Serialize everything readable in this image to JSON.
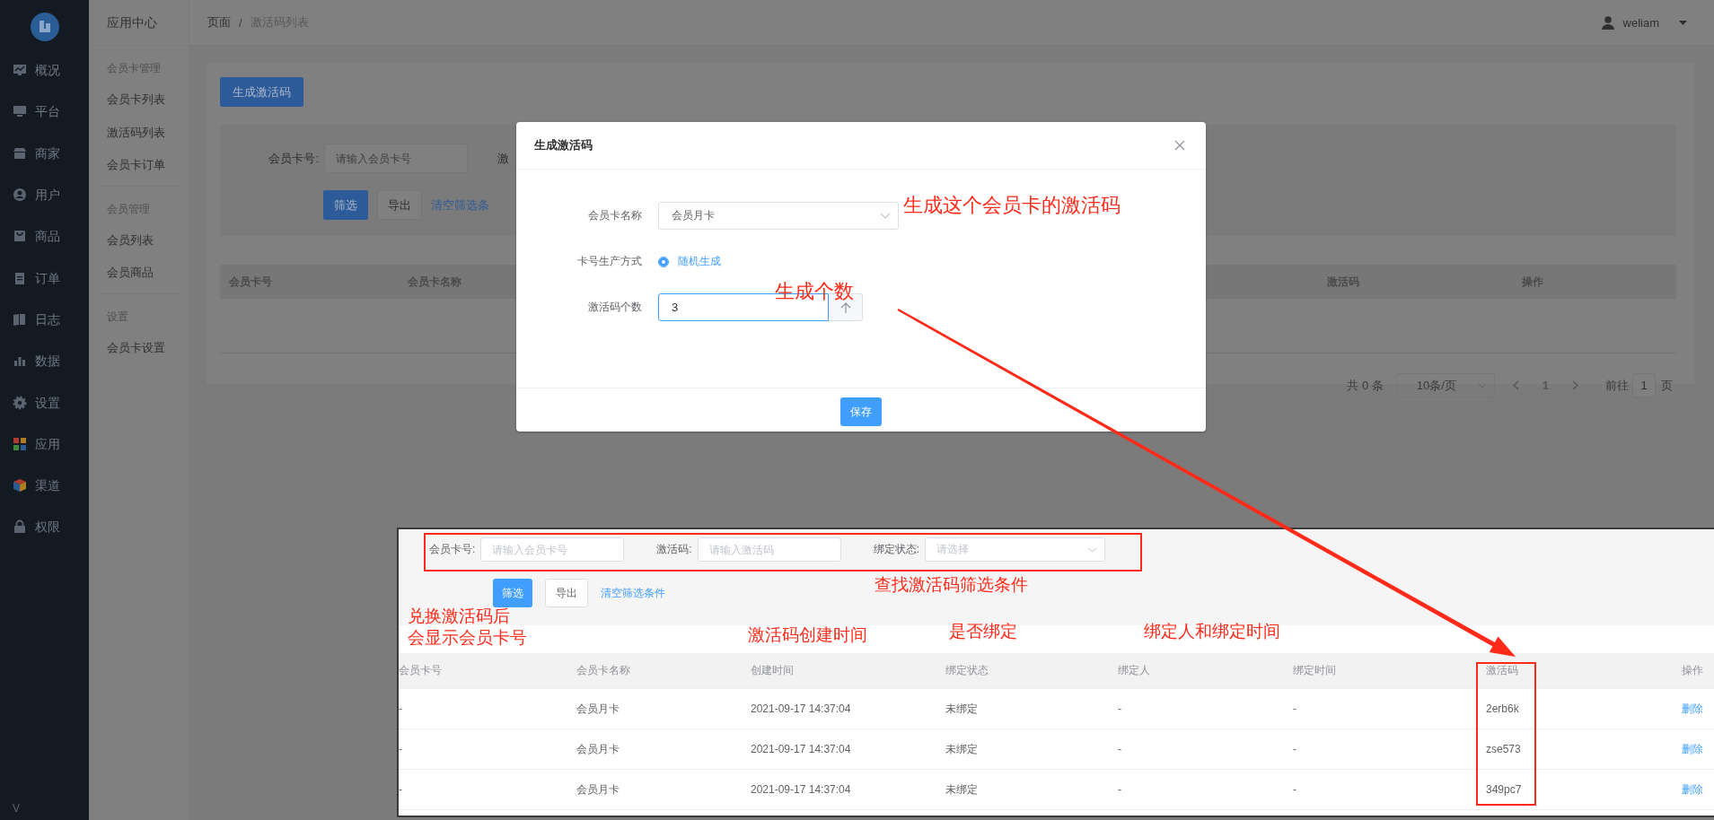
{
  "sidebar": {
    "items": [
      {
        "label": "概况"
      },
      {
        "label": "平台"
      },
      {
        "label": "商家"
      },
      {
        "label": "用户"
      },
      {
        "label": "商品"
      },
      {
        "label": "订单"
      },
      {
        "label": "日志"
      },
      {
        "label": "数据"
      },
      {
        "label": "设置"
      },
      {
        "label": "应用"
      },
      {
        "label": "渠道"
      },
      {
        "label": "权限"
      }
    ],
    "version": "V"
  },
  "submenu": {
    "title": "应用中心",
    "groups": [
      {
        "heading": "会员卡管理",
        "items": [
          "会员卡列表",
          "激活码列表",
          "会员卡订单"
        ]
      },
      {
        "heading": "会员管理",
        "items": [
          "会员列表",
          "会员商品"
        ]
      },
      {
        "heading": "设置",
        "items": [
          "会员卡设置"
        ]
      }
    ]
  },
  "breadcrumb": [
    "页面",
    "激活码列表"
  ],
  "breadcrumb_separator": "/",
  "user": {
    "name": "weliam"
  },
  "page": {
    "primary_button": "生成激活码",
    "filter": {
      "label": "会员卡号:",
      "placeholder": "请输入会员卡号",
      "next_label": "激"
    },
    "buttons": [
      "筛选",
      "导出"
    ],
    "clear_link": "清空筛选条",
    "columns_left": [
      "会员卡号",
      "会员卡名称"
    ],
    "columns_right": [
      "激活码",
      "操作"
    ],
    "pagination": {
      "total": "共 0 条",
      "page_size": "10条/页",
      "page": "1",
      "goto_label": "前往",
      "goto_value": "1",
      "goto_suffix": "页"
    }
  },
  "dialog": {
    "title": "生成激活码",
    "fields": [
      {
        "kind": "select",
        "label": "会员卡名称",
        "value": "会员月卡"
      },
      {
        "kind": "radio",
        "label": "卡号生产方式",
        "options": [
          {
            "label": "随机生成",
            "selected": true
          }
        ]
      },
      {
        "kind": "number",
        "label": "激活码个数",
        "value": "3"
      }
    ],
    "save_button": "保存"
  },
  "inset": {
    "filters": [
      {
        "kind": "input",
        "label": "会员卡号:",
        "placeholder": "请输入会员卡号"
      },
      {
        "kind": "input",
        "label": "激活码:",
        "placeholder": "请输入激活码"
      },
      {
        "kind": "select",
        "label": "绑定状态:",
        "placeholder": "请选择"
      }
    ],
    "buttons": [
      "筛选",
      "导出"
    ],
    "clear_link": "清空筛选条件",
    "columns": [
      "会员卡号",
      "会员卡名称",
      "创建时间",
      "绑定状态",
      "绑定人",
      "绑定时间",
      "激活码",
      "操作"
    ],
    "rows": [
      [
        "-",
        "会员月卡",
        "2021-09-17 14:37:04",
        "未绑定",
        "-",
        "-",
        "2erb6k",
        "删除"
      ],
      [
        "-",
        "会员月卡",
        "2021-09-17 14:37:04",
        "未绑定",
        "-",
        "-",
        "zse573",
        "删除"
      ],
      [
        "-",
        "会员月卡",
        "2021-09-17 14:37:04",
        "未绑定",
        "-",
        "-",
        "349pc7",
        "删除"
      ]
    ]
  },
  "annotations": [
    {
      "text": "生成这个会员卡的激活码"
    },
    {
      "text": "生成个数"
    },
    {
      "text": "查找激活码筛选条件"
    },
    {
      "text": "兑换激活码后"
    },
    {
      "text": "会显示会员卡号"
    },
    {
      "text": "激活码创建时间"
    },
    {
      "text": "是否绑定"
    },
    {
      "text": "绑定人和绑定时间"
    }
  ]
}
